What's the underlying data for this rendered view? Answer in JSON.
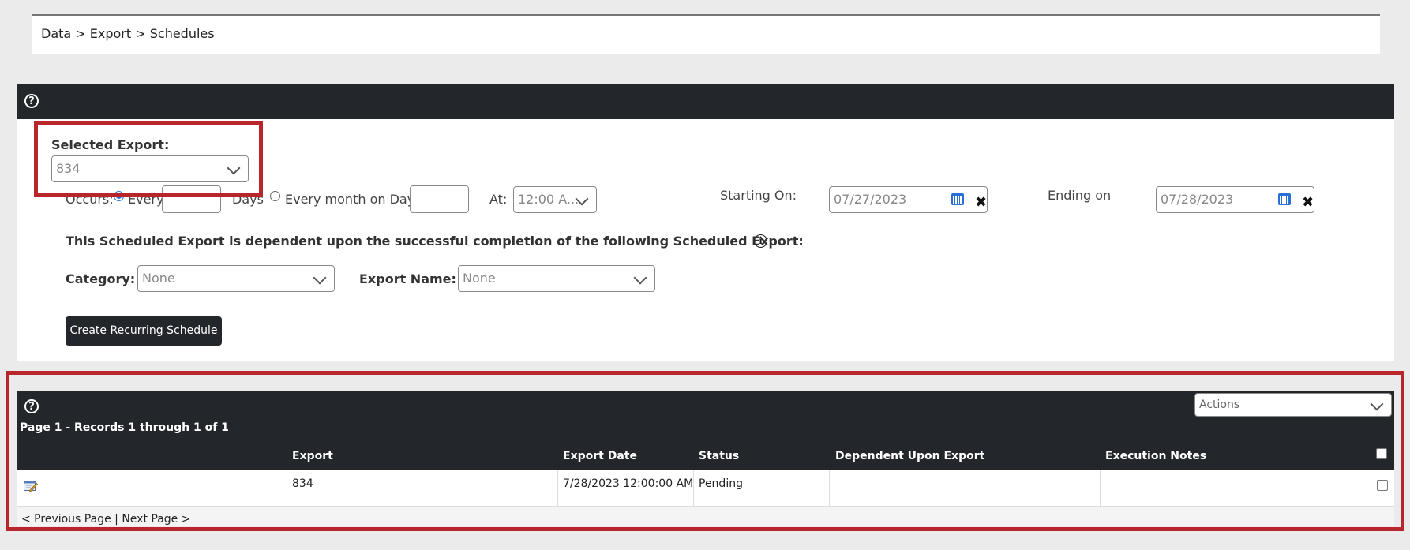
{
  "breadcrumb": "Data > Export > Schedules",
  "schedule": {
    "selected_export_label": "Selected Export:",
    "selected_export_value": "834",
    "occurs_label": "Occurs:",
    "every_label": "Every",
    "days_label": "Days",
    "every_month_label": "Every month on Day",
    "at_label": "At:",
    "at_value": "12:00 A...",
    "starting_label": "Starting On:",
    "starting_value": "07/27/2023",
    "ending_label": "Ending on",
    "ending_value": "07/28/2023",
    "dependency_text": "This Scheduled Export is dependent upon the successful completion of the following Scheduled Export:",
    "category_label": "Category:",
    "category_value": "None",
    "export_name_label": "Export Name:",
    "export_name_value": "None",
    "create_button": "Create Recurring Schedule"
  },
  "grid": {
    "actions_placeholder": "Actions",
    "records_text": "Page 1 - Records 1 through 1 of 1",
    "columns": [
      "Export",
      "Export Date",
      "Status",
      "Dependent Upon Export",
      "Execution Notes"
    ],
    "rows": [
      {
        "export": "834",
        "export_date": "7/28/2023 12:00:00 AM",
        "status": "Pending",
        "dependent": "",
        "notes": ""
      }
    ],
    "prev_page": "< Previous Page",
    "separator": " | ",
    "next_page": "Next Page >"
  },
  "icons": {
    "help": "?",
    "info": "i",
    "clear": "✖"
  },
  "colors": {
    "dark_header": "#23262b",
    "highlight_red": "#b8262b",
    "accent_blue": "#2a6fd6"
  }
}
